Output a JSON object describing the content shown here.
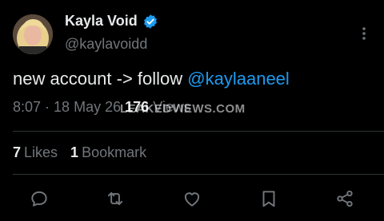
{
  "user": {
    "display_name": "Kayla Void",
    "handle": "@kaylavoidd",
    "verified": true
  },
  "tweet": {
    "text_prefix": "new account -> follow ",
    "mention": "@kaylaaneel"
  },
  "meta": {
    "time": "8:07",
    "separator": " · ",
    "date": "18 May 26",
    "views_count": "176",
    "views_label": "Views"
  },
  "watermark": "LEAKEDVIEWS.COM",
  "stats": {
    "likes_count": "7",
    "likes_label": "Likes",
    "bookmarks_count": "1",
    "bookmarks_label": "Bookmark"
  },
  "colors": {
    "background": "#000000",
    "text": "#e7e9ea",
    "muted": "#71767b",
    "accent": "#1d9bf0",
    "divider": "#2f3336"
  },
  "icons": [
    "reply-icon",
    "repost-icon",
    "like-icon",
    "bookmark-icon",
    "share-icon"
  ]
}
